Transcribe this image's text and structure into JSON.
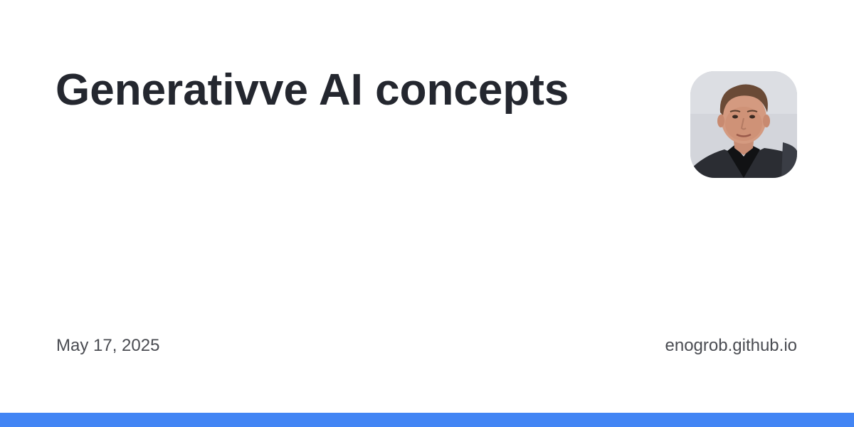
{
  "title": "Generativve AI concepts",
  "date": "May 17, 2025",
  "site": "enogrob.github.io",
  "avatar": {
    "icon": "author-avatar-photo"
  },
  "colors": {
    "background": "#ffffff",
    "title": "#24272f",
    "meta_text": "#4a4c52",
    "accent_bar": "#4285f4"
  }
}
